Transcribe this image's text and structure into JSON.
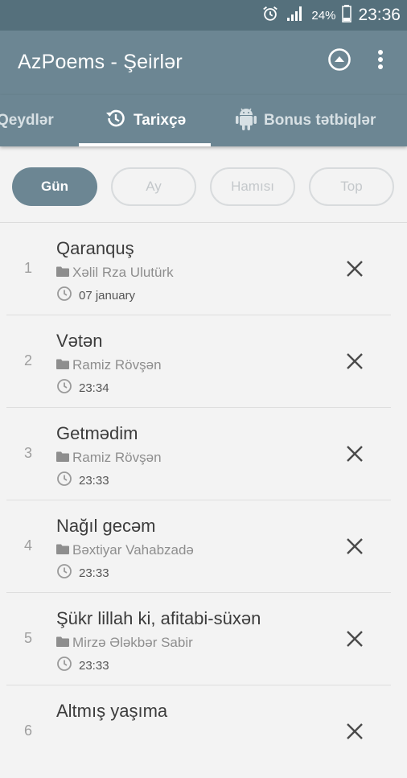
{
  "status_bar": {
    "battery": "24%",
    "time": "23:36"
  },
  "app": {
    "title": "AzPoems - Şeirlər"
  },
  "tabs": [
    {
      "label": "Qeydlər"
    },
    {
      "label": "Tarixçə"
    },
    {
      "label": "Bonus tətbiqlər"
    }
  ],
  "filters": [
    "Gün",
    "Ay",
    "Hamısı",
    "Top"
  ],
  "history": [
    {
      "index": "1",
      "title": "Qaranquş",
      "author": "Xəlil Rza Ulutürk",
      "time": "07 january"
    },
    {
      "index": "2",
      "title": "Vətən",
      "author": "Ramiz Rövşən",
      "time": "23:34"
    },
    {
      "index": "3",
      "title": "Getmədim",
      "author": "Ramiz Rövşən",
      "time": "23:33"
    },
    {
      "index": "4",
      "title": "Nağıl gecəm",
      "author": "Bəxtiyar Vahabzadə",
      "time": "23:33"
    },
    {
      "index": "5",
      "title": "Şükr lillah ki, afitabi-süxən",
      "author": "Mirzə Ələkbər Sabir",
      "time": "23:33"
    },
    {
      "index": "6",
      "title": "Altmış yaşıma",
      "author": "",
      "time": ""
    }
  ],
  "colors": {
    "primary": "#6c8693",
    "status_bar": "#55707c"
  }
}
